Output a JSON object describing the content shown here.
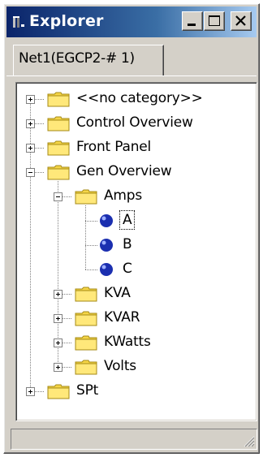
{
  "window": {
    "title": "Explorer",
    "title_icon": "explorer-icon",
    "controls": [
      "minimize-icon",
      "maximize-icon",
      "close-icon"
    ]
  },
  "tabs": [
    {
      "label": "Net1(EGCP2-# 1)",
      "active": true
    }
  ],
  "tree": {
    "nodes": [
      {
        "label": "<<no category>>",
        "icon": "folder-icon",
        "expander": "plus"
      },
      {
        "label": "Control Overview",
        "icon": "folder-icon",
        "expander": "plus"
      },
      {
        "label": "Front Panel",
        "icon": "folder-icon",
        "expander": "plus"
      },
      {
        "label": "Gen Overview",
        "icon": "folder-icon",
        "expander": "minus",
        "children": [
          {
            "label": "Amps",
            "icon": "folder-icon",
            "expander": "minus",
            "children": [
              {
                "label": "A",
                "icon": "blue-ball-icon",
                "selected": true
              },
              {
                "label": "B",
                "icon": "blue-ball-icon"
              },
              {
                "label": "C",
                "icon": "blue-ball-icon"
              }
            ]
          },
          {
            "label": "KVA",
            "icon": "folder-icon",
            "expander": "plus"
          },
          {
            "label": "KVAR",
            "icon": "folder-icon",
            "expander": "plus"
          },
          {
            "label": "KWatts",
            "icon": "folder-icon",
            "expander": "plus"
          },
          {
            "label": "Volts",
            "icon": "folder-icon",
            "expander": "plus"
          }
        ]
      },
      {
        "label": "SPt",
        "icon": "folder-icon",
        "expander": "plus"
      }
    ]
  },
  "statusbar": {
    "text": "",
    "grip_icon": "resize-grip-icon"
  },
  "colors": {
    "titlebar_start": "#0a246a",
    "titlebar_end": "#a6caf0",
    "window_bg": "#d4d0c8",
    "folder": "#f5d547",
    "node_ball": "#1b2fb0"
  }
}
